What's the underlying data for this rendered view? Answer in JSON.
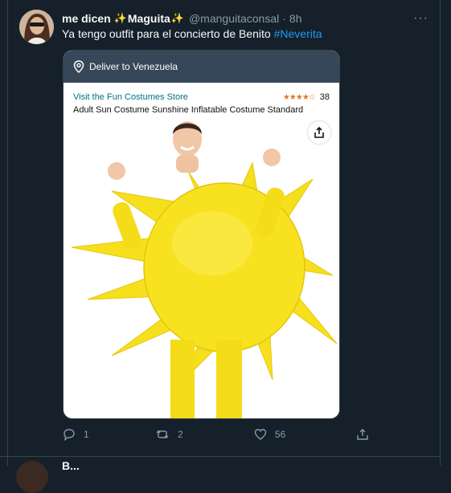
{
  "tweet": {
    "display_name": "me dicen",
    "display_name_suffix": "Maguita",
    "handle": "@manguitaconsal",
    "separator": "·",
    "time": "8h",
    "more_label": "···",
    "text_prefix": "Ya tengo outfit para el concierto de Benito ",
    "hashtag": "#Neverita"
  },
  "card": {
    "deliver_label": "Deliver to Venezuela",
    "store_link": "Visit the Fun Costumes Store",
    "rating_stars": 3.5,
    "rating_count": "38",
    "product_title": "Adult Sun Costume Sunshine Inflatable Costume Standard"
  },
  "actions": {
    "replies": "1",
    "retweets": "2",
    "likes": "56"
  },
  "next_tweet": {
    "name_fragment": "B..."
  },
  "colors": {
    "background": "#15202b",
    "accent": "#1d9bf0",
    "muted": "#8b98a5",
    "amazon_bar": "#37475a",
    "amazon_link": "#007185",
    "star": "#de7921"
  }
}
